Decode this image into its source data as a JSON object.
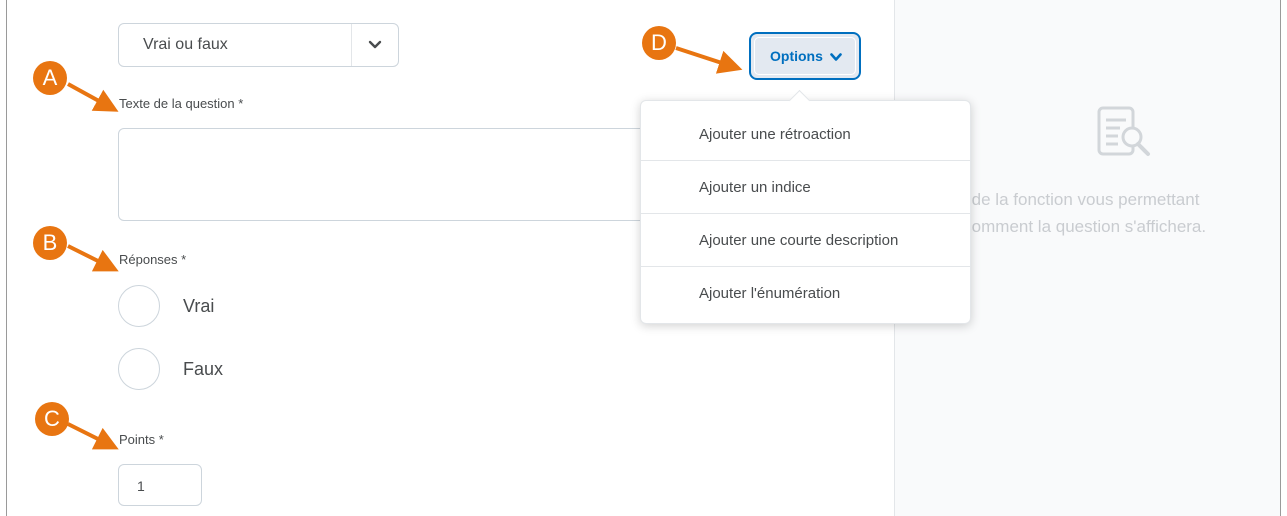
{
  "editor": {
    "question_type": "Vrai ou faux",
    "question_text_label": "Texte de la question",
    "answers_label": "Réponses",
    "answers": [
      {
        "label": "Vrai"
      },
      {
        "label": "Faux"
      }
    ],
    "points_label": "Points",
    "points_value": "1",
    "required_marker": "*"
  },
  "options": {
    "button_label": "Options",
    "menu_items": [
      "Ajouter une rétroaction",
      "Ajouter un indice",
      "Ajouter une courte description",
      "Ajouter l'énumération"
    ]
  },
  "preview": {
    "line1": "git de la fonction vous permettant",
    "line2": "ir comment la question s'affichera."
  },
  "callouts": {
    "a": "A",
    "b": "B",
    "c": "C",
    "d": "D"
  },
  "colors": {
    "accent": "#006fbf",
    "callout": "#e87511",
    "border": "#cdd5dc",
    "preview_bg": "#f9fafb"
  }
}
